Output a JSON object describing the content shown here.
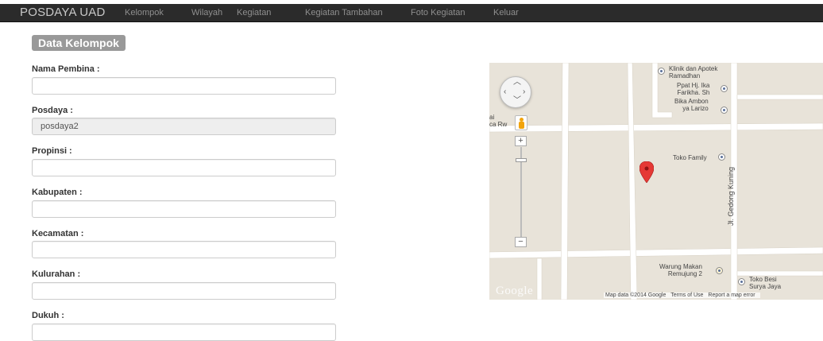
{
  "navbar": {
    "brand": "POSDAYA UAD",
    "items": [
      "Kelompok",
      "Wilayah",
      "Kegiatan",
      "Kegiatan Tambahan",
      "Foto Kegiatan",
      "Keluar"
    ]
  },
  "form": {
    "title": "Data Kelompok",
    "fields": [
      {
        "label": "Nama Pembina :",
        "value": "",
        "readonly": false
      },
      {
        "label": "Posdaya :",
        "value": "posdaya2",
        "readonly": true
      },
      {
        "label": "Propinsi :",
        "value": "",
        "readonly": false
      },
      {
        "label": "Kabupaten :",
        "value": "",
        "readonly": false
      },
      {
        "label": "Kecamatan :",
        "value": "",
        "readonly": false
      },
      {
        "label": "Kulurahan :",
        "value": "",
        "readonly": false
      },
      {
        "label": "Dukuh :",
        "value": "",
        "readonly": false
      }
    ]
  },
  "map": {
    "labels": {
      "klinik": "Klinik dan Apotek\nRamadhan",
      "ppat": "Ppat Hj. Ika\nFarikha. Sh",
      "bika": "Bika Ambon\nya Larizo",
      "toko_family": "Toko Family",
      "jl": "Jl. Gedong Kuning",
      "warung": "Warung Makan\nRemujung 2",
      "toko_besi": "Toko Besi\nSurya Jaya",
      "left_fragment": "ai\nca Rw"
    },
    "google_logo": "Google",
    "attribution": {
      "data": "Map data ©2014 Google",
      "terms": "Terms of Use",
      "report": "Report a map error"
    },
    "controls": {
      "zoom_in": "+",
      "zoom_out": "−"
    },
    "colors": {
      "land": "#e8e3d9",
      "road": "#ffffff",
      "marker": "#e53935"
    }
  }
}
